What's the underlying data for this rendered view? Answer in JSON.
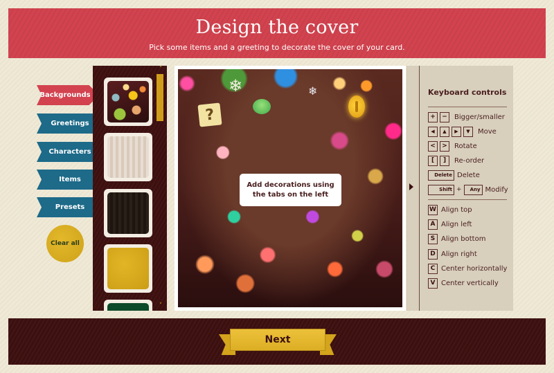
{
  "header": {
    "title": "Design the cover",
    "subtitle": "Pick some items and a greeting to decorate the cover of your card."
  },
  "tabs": [
    {
      "label": "Backgrounds",
      "active": true
    },
    {
      "label": "Greetings",
      "active": false
    },
    {
      "label": "Characters",
      "active": false
    },
    {
      "label": "Items",
      "active": false
    },
    {
      "label": "Presets",
      "active": false
    }
  ],
  "clear_all_label": "Clear all",
  "thumbnails": [
    {
      "name": "bokeh-lights",
      "selected": true
    },
    {
      "name": "white-knit"
    },
    {
      "name": "black-knit"
    },
    {
      "name": "gold-glitter"
    },
    {
      "name": "green-pattern"
    }
  ],
  "scroll": {
    "up_icon": "chevron-up-icon",
    "down_icon": "chevron-down-icon",
    "up_glyph": "˄",
    "down_glyph": "˅"
  },
  "canvas": {
    "hint": "Add decorations using the tabs on the left",
    "decorations": [
      "question-block",
      "snowflake",
      "snowflake",
      "green-shell",
      "gold-coin"
    ],
    "glyphs": {
      "snowflake": "❄",
      "question": "?"
    }
  },
  "controls": {
    "title": "Keyboard controls",
    "rows": [
      {
        "keys": [
          "+",
          "−"
        ],
        "label": "Bigger/smaller"
      },
      {
        "keys": [
          "◀",
          "▲",
          "▶",
          "▼"
        ],
        "label": "Move"
      },
      {
        "keys": [
          "<",
          ">"
        ],
        "label": "Rotate"
      },
      {
        "keys": [
          "[",
          "]"
        ],
        "label": "Re-order"
      },
      {
        "keys": [
          "Delete"
        ],
        "label": "Delete"
      },
      {
        "keys": [
          "Shift",
          "Any"
        ],
        "joiner": "+",
        "label": "Modify"
      }
    ],
    "align_rows": [
      {
        "key": "W",
        "label": "Align top"
      },
      {
        "key": "A",
        "label": "Align left"
      },
      {
        "key": "S",
        "label": "Align bottom"
      },
      {
        "key": "D",
        "label": "Align right"
      },
      {
        "key": "C",
        "label": "Center horizontally"
      },
      {
        "key": "V",
        "label": "Center vertically"
      }
    ]
  },
  "footer": {
    "next_label": "Next"
  },
  "colors": {
    "red": "#d2434f",
    "blue": "#1d6a89",
    "gold": "#d9ac1f",
    "maroon": "#3c0f0f",
    "cream": "#efe9d6"
  }
}
